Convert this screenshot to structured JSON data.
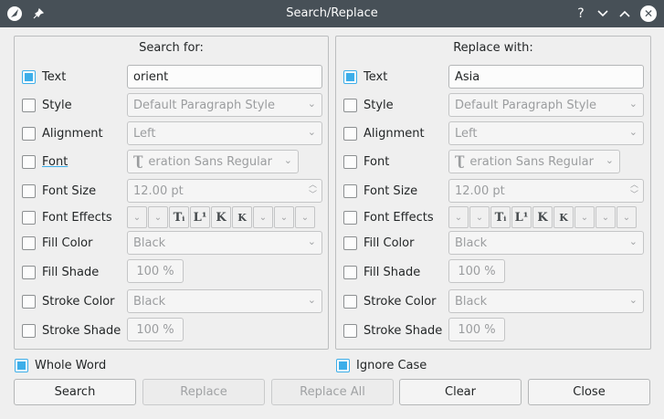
{
  "window": {
    "title": "Search/Replace",
    "help": "?",
    "minimize": "⌄",
    "maximize": "⌃",
    "close": "✕"
  },
  "search": {
    "heading": "Search for:",
    "text": {
      "label": "Text",
      "checked": true,
      "value": "orient"
    },
    "style": {
      "label": "Style",
      "value": "Default Paragraph Style"
    },
    "alignment": {
      "label": "Alignment",
      "value": "Left"
    },
    "font": {
      "label": "Font",
      "value": "eration Sans Regular"
    },
    "font_size": {
      "label": "Font Size",
      "value": "12.00 pt"
    },
    "font_effects": {
      "label": "Font Effects"
    },
    "fill_color": {
      "label": "Fill Color",
      "value": "Black"
    },
    "fill_shade": {
      "label": "Fill Shade",
      "value": "100 %"
    },
    "stroke_color": {
      "label": "Stroke Color",
      "value": "Black"
    },
    "stroke_shade": {
      "label": "Stroke Shade",
      "value": "100 %"
    }
  },
  "replace": {
    "heading": "Replace with:",
    "text": {
      "label": "Text",
      "checked": true,
      "value": "Asia"
    },
    "style": {
      "label": "Style",
      "value": "Default Paragraph Style"
    },
    "alignment": {
      "label": "Alignment",
      "value": "Left"
    },
    "font": {
      "label": "Font",
      "value": "eration Sans Regular"
    },
    "font_size": {
      "label": "Font Size",
      "value": "12.00 pt"
    },
    "font_effects": {
      "label": "Font Effects"
    },
    "fill_color": {
      "label": "Fill Color",
      "value": "Black"
    },
    "fill_shade": {
      "label": "Fill Shade",
      "value": "100 %"
    },
    "stroke_color": {
      "label": "Stroke Color",
      "value": "Black"
    },
    "stroke_shade": {
      "label": "Stroke Shade",
      "value": "100 %"
    }
  },
  "options": {
    "whole_word": {
      "label": "Whole Word",
      "checked": true
    },
    "ignore_case": {
      "label": "Ignore Case",
      "checked": true
    }
  },
  "buttons": {
    "search": "Search",
    "replace": "Replace",
    "replace_all": "Replace All",
    "clear": "Clear",
    "close": "Close"
  },
  "colors": {
    "titlebar": "#475057",
    "accent": "#3daee9"
  }
}
